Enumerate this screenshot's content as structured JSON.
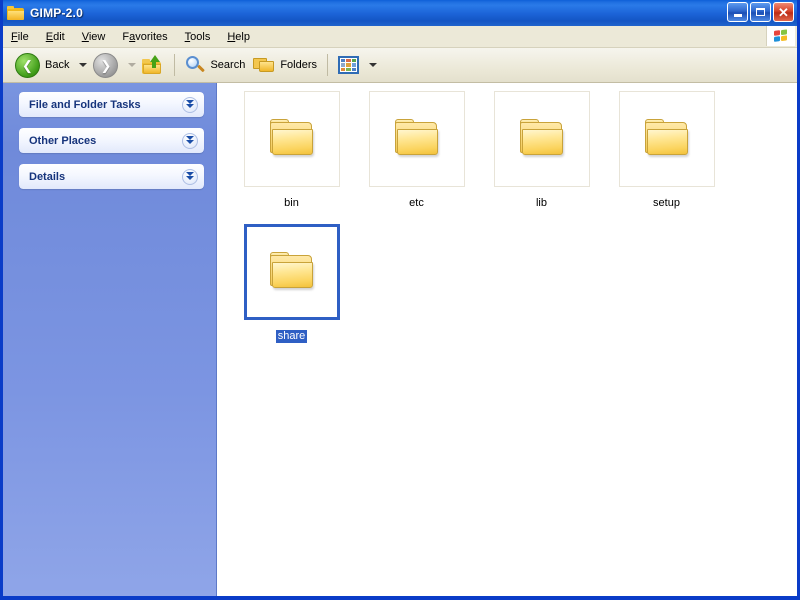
{
  "window": {
    "title": "GIMP-2.0",
    "title_icon": "folder-icon",
    "caption": {
      "minimize": "–",
      "maximize": "□",
      "close": "✕"
    }
  },
  "menubar": {
    "items": [
      {
        "pre": "",
        "accel": "F",
        "post": "ile",
        "name": "menu-file"
      },
      {
        "pre": "",
        "accel": "E",
        "post": "dit",
        "name": "menu-edit"
      },
      {
        "pre": "",
        "accel": "V",
        "post": "iew",
        "name": "menu-view"
      },
      {
        "pre": "F",
        "accel": "a",
        "post": "vorites",
        "name": "menu-favorites"
      },
      {
        "pre": "",
        "accel": "T",
        "post": "ools",
        "name": "menu-tools"
      },
      {
        "pre": "",
        "accel": "H",
        "post": "elp",
        "name": "menu-help"
      }
    ],
    "brand_icon": "windows-flag-icon"
  },
  "toolbar": {
    "back_label": "Back",
    "back_icon": "back-arrow-icon",
    "forward_icon": "forward-arrow-icon",
    "up_icon": "up-folder-icon",
    "search_label": "Search",
    "search_icon": "search-icon",
    "folders_label": "Folders",
    "folders_icon": "folders-icon",
    "views_icon": "views-icon",
    "views_swatches": [
      "#4f7fc4",
      "#d86a4a",
      "#5aa24a",
      "#8fa8cc",
      "#e0a03a",
      "#6f9fd8",
      "#e08a3a",
      "#7fb44f",
      "#4f7fc4"
    ]
  },
  "sidebar": {
    "panels": [
      {
        "title": "File and Folder Tasks",
        "expander": "chevron-down-double-icon"
      },
      {
        "title": "Other Places",
        "expander": "chevron-down-double-icon"
      },
      {
        "title": "Details",
        "expander": "chevron-down-double-icon"
      }
    ]
  },
  "content": {
    "view_mode": "Thumbnails",
    "items": [
      {
        "label": "bin",
        "icon": "folder-icon",
        "selected": false
      },
      {
        "label": "etc",
        "icon": "folder-icon",
        "selected": false
      },
      {
        "label": "lib",
        "icon": "folder-icon",
        "selected": false
      },
      {
        "label": "setup",
        "icon": "folder-icon",
        "selected": false
      },
      {
        "label": "share",
        "icon": "folder-icon",
        "selected": true
      }
    ]
  },
  "colors": {
    "title_blue": "#1b62d6",
    "menu_beige": "#ece9d8",
    "sidebar_blue": "#7c95e2",
    "selection_blue": "#2f5fc4",
    "folder_yellow": "#f6cd56"
  }
}
